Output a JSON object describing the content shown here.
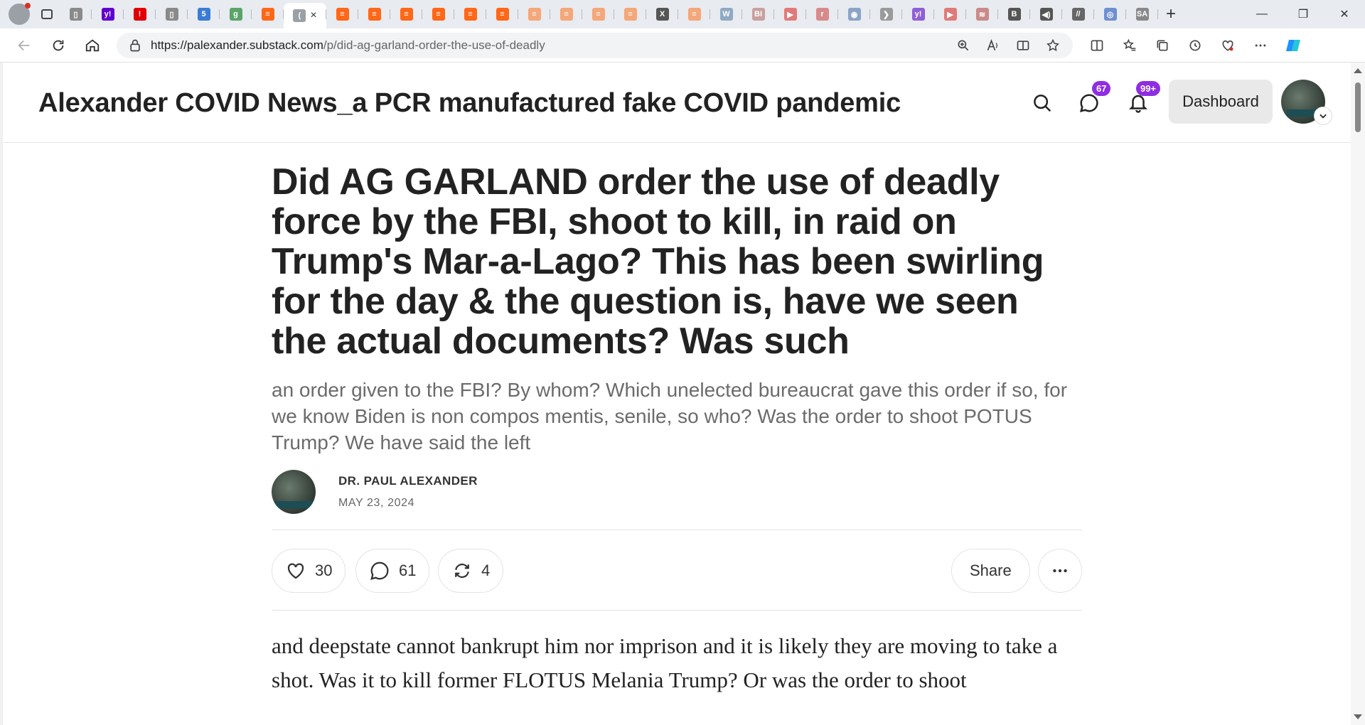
{
  "browser": {
    "tabs": [
      {
        "icon": "page-icon",
        "color": "#8a8a8a",
        "glyph": "▯"
      },
      {
        "icon": "yahoo-icon",
        "color": "#6001d2",
        "glyph": "y!"
      },
      {
        "icon": "red-alert-icon",
        "color": "#e00000",
        "glyph": "!"
      },
      {
        "icon": "page-icon",
        "color": "#8a8a8a",
        "glyph": "▯"
      },
      {
        "icon": "five-icon",
        "color": "#3a7bd5",
        "glyph": "5"
      },
      {
        "icon": "grammarly-icon",
        "color": "#5aa469",
        "glyph": "g"
      },
      {
        "icon": "substack-icon",
        "color": "#ff6719",
        "glyph": "≡"
      },
      {
        "icon": "loading-icon",
        "color": "#9aa0a6",
        "glyph": "("
      },
      {
        "icon": "substack-icon",
        "color": "#ff6719",
        "glyph": "≡"
      },
      {
        "icon": "substack-icon",
        "color": "#ff6719",
        "glyph": "≡"
      },
      {
        "icon": "substack-icon",
        "color": "#ff6719",
        "glyph": "≡"
      },
      {
        "icon": "substack-icon",
        "color": "#ff6719",
        "glyph": "≡"
      },
      {
        "icon": "substack-icon",
        "color": "#ff6719",
        "glyph": "≡"
      },
      {
        "icon": "substack-icon",
        "color": "#ff6719",
        "glyph": "≡"
      },
      {
        "icon": "substack-icon",
        "color": "#f4a77a",
        "glyph": "≡"
      },
      {
        "icon": "substack-icon",
        "color": "#f4a77a",
        "glyph": "≡"
      },
      {
        "icon": "substack-icon",
        "color": "#f4a77a",
        "glyph": "≡"
      },
      {
        "icon": "substack-icon",
        "color": "#f4a77a",
        "glyph": "≡"
      },
      {
        "icon": "x-icon",
        "color": "#555555",
        "glyph": "X"
      },
      {
        "icon": "substack-icon",
        "color": "#f4a77a",
        "glyph": "≡"
      },
      {
        "icon": "wordpress-icon",
        "color": "#8fa9c3",
        "glyph": "W"
      },
      {
        "icon": "bi-icon",
        "color": "#c9a0a0",
        "glyph": "BI"
      },
      {
        "icon": "youtube-icon",
        "color": "#e07a7a",
        "glyph": "▶"
      },
      {
        "icon": "r-icon",
        "color": "#d88a8a",
        "glyph": "r"
      },
      {
        "icon": "podcast-icon",
        "color": "#8ca3c7",
        "glyph": "◉"
      },
      {
        "icon": "arrow-icon",
        "color": "#9a9a9a",
        "glyph": "❯"
      },
      {
        "icon": "yahoo-icon",
        "color": "#8e5fd6",
        "glyph": "y!"
      },
      {
        "icon": "youtube-icon",
        "color": "#e07a7a",
        "glyph": "▶"
      },
      {
        "icon": "bank-icon",
        "color": "#c98a8a",
        "glyph": "≋"
      },
      {
        "icon": "b-icon",
        "color": "#555555",
        "glyph": "B"
      },
      {
        "icon": "audio-icon",
        "color": "#555555",
        "glyph": "◀)"
      },
      {
        "icon": "ww-icon",
        "color": "#666666",
        "glyph": "//"
      },
      {
        "icon": "globe-icon",
        "color": "#6f8fd1",
        "glyph": "◎"
      },
      {
        "icon": "sciam-icon",
        "color": "#888888",
        "glyph": "SA"
      }
    ],
    "active_tab_after": 7,
    "active_close": "×",
    "new_tab": "+",
    "window_controls": [
      "—",
      "❐",
      "✕"
    ],
    "url_host": "https://palexander.substack.com",
    "url_path": "/p/did-ag-garland-order-the-use-of-deadly"
  },
  "site": {
    "title": "Alexander COVID News_a PCR manufactured fake COVID pandemic",
    "chat_badge": "67",
    "notif_badge": "99+",
    "dashboard_label": "Dashboard",
    "accent": "#8e2de2"
  },
  "article": {
    "headline": "Did AG GARLAND order the use of deadly force by the FBI, shoot to kill, in raid on Trump's Mar-a-Lago? This has been swirling for the day & the question is, have we seen the actual documents? Was such",
    "subtitle": "an order given to the FBI? By whom? Which unelected bureaucrat gave this order if so, for we know Biden is non compos mentis, senile, so who? Was the order to shoot POTUS Trump? We have said the left",
    "author": "DR. PAUL ALEXANDER",
    "date": "MAY 23, 2024",
    "likes": "30",
    "comments": "61",
    "restacks": "4",
    "share_label": "Share",
    "body": "and deepstate cannot bankrupt him nor imprison and it is likely they are moving to take a shot. Was it to kill former FLOTUS Melania Trump? Or was the order to shoot"
  }
}
